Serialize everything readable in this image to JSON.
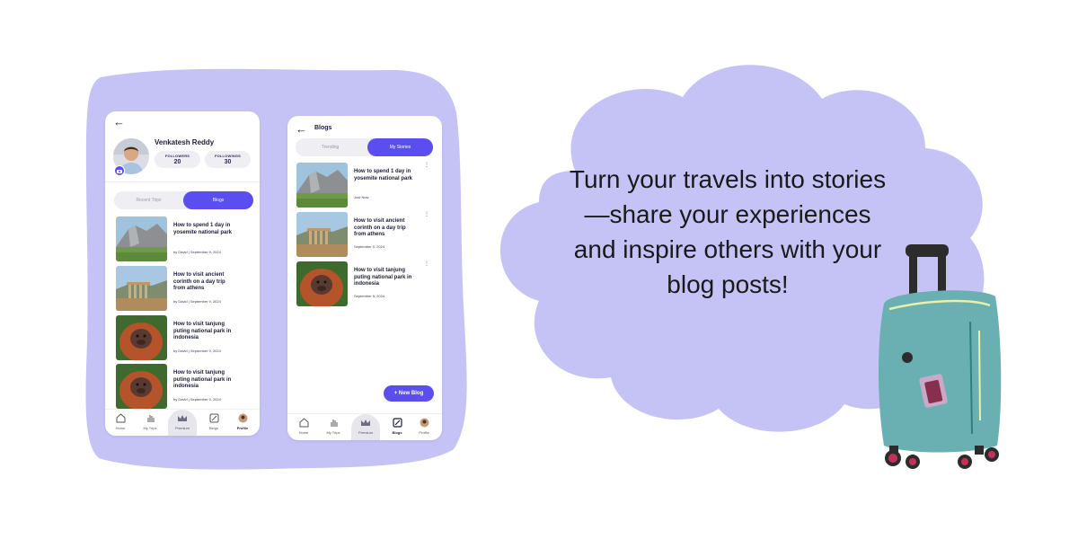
{
  "colors": {
    "accent": "#5b4ef0",
    "lavender": "#c5c3f5",
    "suitcase": "#6ab0b3"
  },
  "profile_screen": {
    "user_name": "Venkatesh Reddy",
    "followers_label": "FOLLOWERS",
    "followers_count": "20",
    "followings_label": "FOLLOWINGS",
    "followings_count": "30",
    "tabs": [
      {
        "label": "Recent Trips",
        "active": false
      },
      {
        "label": "Blogs",
        "active": true
      }
    ],
    "posts": [
      {
        "title": "How to spend 1 day in yosemite national park",
        "meta": "by David  |  September 9, 2024",
        "thumb": "mountain"
      },
      {
        "title": "How to visit ancient corinth on a day trip from athens",
        "meta": "by David  |  September 9, 2024",
        "thumb": "ruins"
      },
      {
        "title": "How to visit tanjung puting national park in indonesia",
        "meta": "by David  |  September 9, 2024",
        "thumb": "orangutan"
      },
      {
        "title": "How to visit tanjung puting national park in indonesia",
        "meta": "by David  |  September 9, 2024",
        "thumb": "orangutan"
      }
    ],
    "nav": [
      {
        "label": "Home",
        "icon": "home-icon",
        "active": false
      },
      {
        "label": "My Trips",
        "icon": "hand-icon",
        "active": false
      },
      {
        "label": "Premium",
        "icon": "crown-icon",
        "active": false
      },
      {
        "label": "Blogs",
        "icon": "edit-icon",
        "active": false
      },
      {
        "label": "Profile",
        "icon": "avatar-icon",
        "active": true
      }
    ]
  },
  "blogs_screen": {
    "title": "Blogs",
    "tabs": [
      {
        "label": "Trending",
        "active": false
      },
      {
        "label": "My Stories",
        "active": true
      }
    ],
    "posts": [
      {
        "title": "How to spend 1 day in yosemite national park",
        "meta": "Just Now",
        "thumb": "mountain"
      },
      {
        "title": "How to visit ancient corinth on a day trip from athens",
        "meta": "September 9, 2024",
        "thumb": "ruins"
      },
      {
        "title": "How to visit tanjung puting national park in indonesia",
        "meta": "September 9, 2024",
        "thumb": "orangutan"
      }
    ],
    "new_blog_label": "+ New Blog",
    "nav": [
      {
        "label": "Home",
        "icon": "home-icon",
        "active": false
      },
      {
        "label": "My Trips",
        "icon": "hand-icon",
        "active": false
      },
      {
        "label": "Premium",
        "icon": "crown-icon",
        "active": false
      },
      {
        "label": "Blogs",
        "icon": "edit-icon",
        "active": true
      },
      {
        "label": "Profile",
        "icon": "avatar-icon",
        "active": false
      }
    ]
  },
  "tagline": "Turn your travels into stories—share your experiences and inspire others with your blog posts!"
}
